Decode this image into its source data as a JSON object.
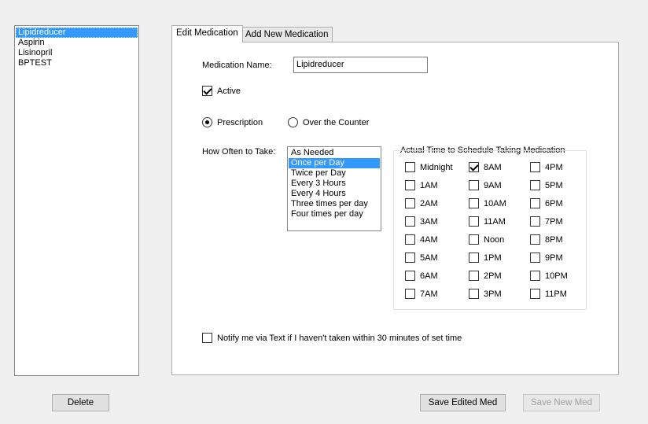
{
  "medications": [
    {
      "name": "Lipidreducer",
      "selected": true
    },
    {
      "name": "Aspirin",
      "selected": false
    },
    {
      "name": "Lisinopril",
      "selected": false
    },
    {
      "name": "BPTEST",
      "selected": false
    }
  ],
  "tabs": {
    "edit_label": "Edit Medication",
    "add_label": "Add New Medication"
  },
  "form": {
    "name_label": "Medication Name:",
    "name_value": "Lipidreducer",
    "active_label": "Active",
    "active_checked": true,
    "prescription_label": "Prescription",
    "otc_label": "Over the Counter",
    "selected_type": "prescription",
    "how_often_label": "How Often to Take:",
    "frequency_options": [
      "As Needed",
      "Once per Day",
      "Twice per Day",
      "Every 3 Hours",
      "Every 4 Hours",
      "Three times per day",
      "Four times per day"
    ],
    "frequency_selected": "Once per Day",
    "schedule_title": "Actual Time to Schedule Taking Medication",
    "times_col1": [
      "Midnight",
      "1AM",
      "2AM",
      "3AM",
      "4AM",
      "5AM",
      "6AM",
      "7AM"
    ],
    "times_col2": [
      "8AM",
      "9AM",
      "10AM",
      "11AM",
      "Noon",
      "1PM",
      "2PM",
      "3PM"
    ],
    "times_col3": [
      "4PM",
      "5PM",
      "6PM",
      "7PM",
      "8PM",
      "9PM",
      "10PM",
      "11PM"
    ],
    "checked_times": [
      "8AM"
    ],
    "notify_label": "Notify me via Text if I haven't taken within 30 minutes of set time",
    "notify_checked": false
  },
  "buttons": {
    "delete": "Delete",
    "save_edited": "Save Edited Med",
    "save_new": "Save New Med"
  }
}
